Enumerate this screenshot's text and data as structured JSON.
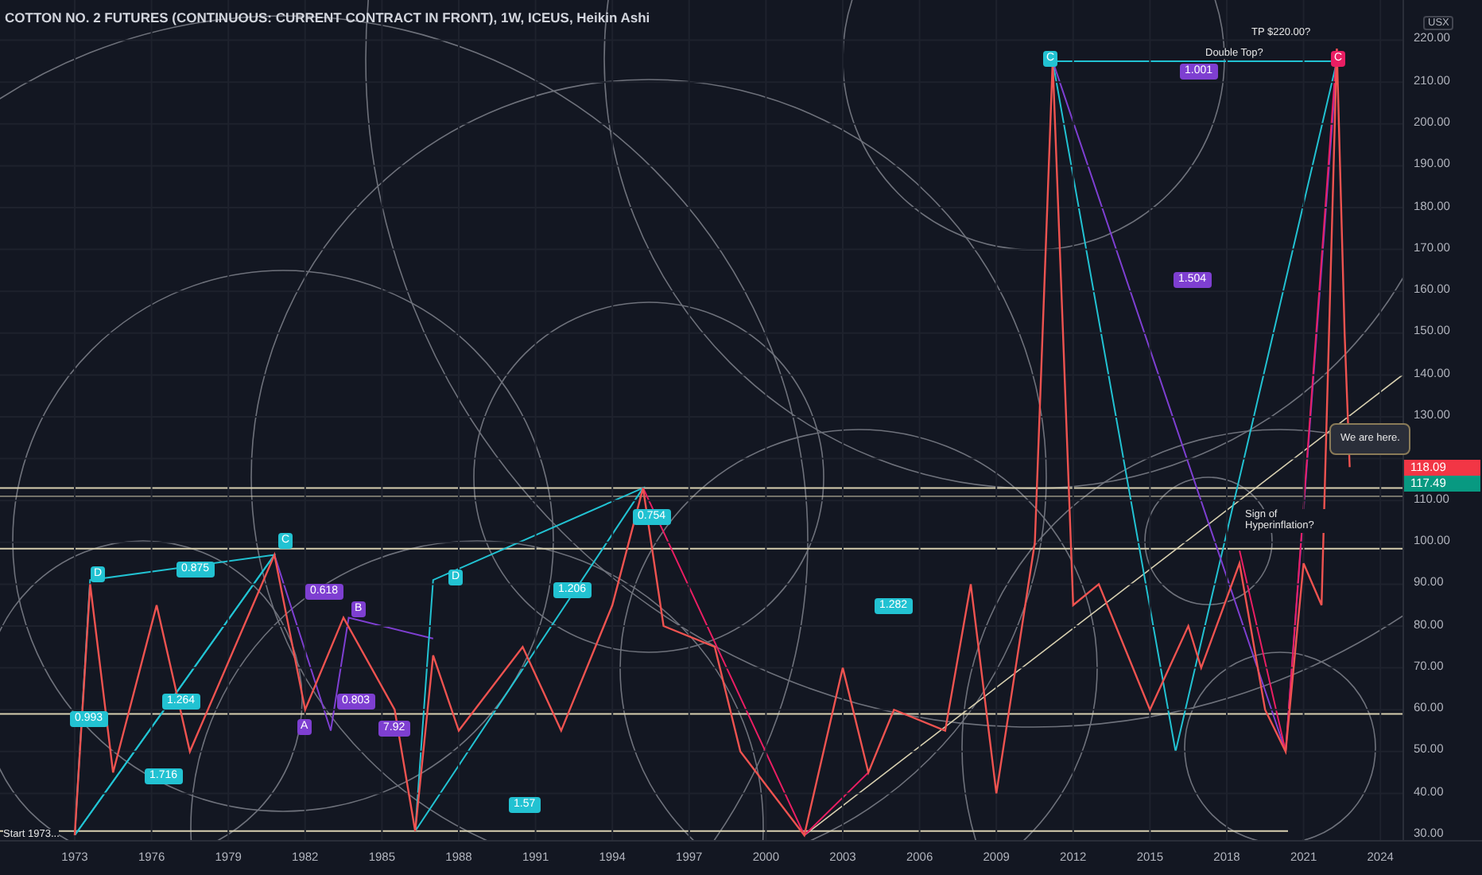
{
  "title": "COTTON NO. 2 FUTURES (CONTINUOUS: CURRENT CONTRACT IN FRONT), 1W, ICEUS, Heikin Ashi",
  "annotations": [
    {
      "kind": "note",
      "text": "Start 1973..."
    },
    {
      "kind": "note",
      "text": "Double Top?"
    },
    {
      "kind": "note",
      "text": "TP $220.00?"
    },
    {
      "kind": "note",
      "text": "Sign of Hyperinflation?"
    },
    {
      "kind": "callout",
      "text": "We are here."
    }
  ],
  "fib_labels": [
    {
      "text": "0.875",
      "color": "#22c2d2"
    },
    {
      "text": "0.618",
      "color": "#7e3fd1"
    },
    {
      "text": "1.264",
      "color": "#22c2d2"
    },
    {
      "text": "0.993",
      "color": "#22c2d2"
    },
    {
      "text": "1.716",
      "color": "#22c2d2"
    },
    {
      "text": "0.803",
      "color": "#7e3fd1"
    },
    {
      "text": "7.92",
      "color": "#7e3fd1"
    },
    {
      "text": "1.206",
      "color": "#22c2d2"
    },
    {
      "text": "1.57",
      "color": "#22c2d2"
    },
    {
      "text": "0.754",
      "color": "#22c2d2"
    },
    {
      "text": "1.282",
      "color": "#22c2d2"
    },
    {
      "text": "1.001",
      "color": "#7e3fd1"
    },
    {
      "text": "1.504",
      "color": "#7e3fd1"
    }
  ],
  "pattern_points": [
    {
      "text": "D",
      "color": "#22c2d2"
    },
    {
      "text": "C",
      "color": "#22c2d2"
    },
    {
      "text": "B",
      "color": "#7e3fd1"
    },
    {
      "text": "A",
      "color": "#7e3fd1"
    },
    {
      "text": "D",
      "color": "#22c2d2"
    },
    {
      "text": "C",
      "color": "#22c2d2"
    },
    {
      "text": "C",
      "color": "#e91e63"
    }
  ],
  "chart_data": {
    "type": "line",
    "x": [
      1973,
      1973.6,
      1974.5,
      1976.2,
      1977.5,
      1980.8,
      1982,
      1983.5,
      1985.5,
      1986.3,
      1987,
      1988,
      1990.5,
      1992,
      1994,
      1995.2,
      1996,
      1998,
      1999,
      2001.5,
      2003,
      2004,
      2005,
      2007,
      2008,
      2009,
      2010.5,
      2011.2,
      2011.6,
      2012,
      2013,
      2015,
      2016.5,
      2017,
      2018.5,
      2019.5,
      2020.3,
      2021,
      2021.7,
      2022.3,
      2022.6,
      2022.8
    ],
    "series": [
      {
        "color": "#ef5350",
        "values": [
          30,
          90,
          45,
          85,
          50,
          97,
          60,
          82,
          60,
          31,
          73,
          55,
          75,
          55,
          85,
          113,
          80,
          75,
          50,
          30,
          70,
          45,
          60,
          55,
          90,
          40,
          100,
          215,
          150,
          85,
          90,
          60,
          80,
          70,
          95,
          60,
          50,
          95,
          85,
          218,
          150,
          118
        ]
      }
    ],
    "grid": true,
    "xlim": [
      1970,
      2028
    ],
    "ylim": [
      30,
      230
    ],
    "xticks": [
      1973,
      1976,
      1979,
      1982,
      1985,
      1988,
      1991,
      1994,
      1997,
      2000,
      2003,
      2006,
      2009,
      2012,
      2015,
      2018,
      2021,
      2024
    ],
    "yticks": [
      {
        "value": 220,
        "label": "220.00"
      },
      {
        "value": 210,
        "label": "210.00"
      },
      {
        "value": 200,
        "label": "200.00"
      },
      {
        "value": 190,
        "label": "190.00"
      },
      {
        "value": 180,
        "label": "180.00"
      },
      {
        "value": 170,
        "label": "170.00"
      },
      {
        "value": 160,
        "label": "160.00"
      },
      {
        "value": 150,
        "label": "150.00"
      },
      {
        "value": 140,
        "label": "140.00"
      },
      {
        "value": 130,
        "label": "130.00"
      },
      {
        "value": 110,
        "label": "110.00"
      },
      {
        "value": 100,
        "label": "100.00"
      },
      {
        "value": 90,
        "label": "90.00"
      },
      {
        "value": 80,
        "label": "80.00"
      },
      {
        "value": 70,
        "label": "70.00"
      },
      {
        "value": 60,
        "label": "60.00"
      },
      {
        "value": 50,
        "label": "50.00"
      },
      {
        "value": 40,
        "label": "40.00"
      },
      {
        "value": 30,
        "label": "30.00"
      }
    ]
  },
  "price_axis": {
    "unit": "USX"
  },
  "price_tags": [
    {
      "text": "118.09",
      "color": "#f23645"
    },
    {
      "text": "117.49",
      "color": "#089981"
    }
  ]
}
